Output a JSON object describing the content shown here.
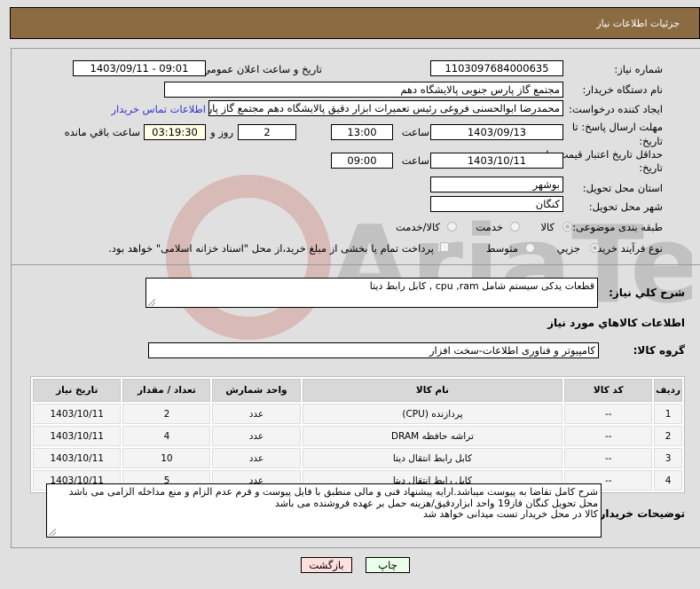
{
  "header": {
    "title": "جزئیات اطلاعات نیاز"
  },
  "fields": {
    "need_number_label": "شماره نیاز:",
    "need_number": "1103097684000635",
    "announce_label": "تاريخ و ساعت اعلان عمومي:",
    "announce_value": "1403/09/11 - 09:01",
    "buyer_org_label": "نام دستگاه خریدار:",
    "buyer_org": "مجتمع گاز پارس جنوبی  پالایشگاه دهم",
    "creator_label": "ایجاد کننده درخواست:",
    "creator": "محمدرضا ابوالحسنی فروغی رئیس تعمیرات ابزار دقیق پالایشگاه دهم  مجتمع گاز پارس جنوبی",
    "buyer_contact_link": "اطلاعات تماس خریدار",
    "reply_deadline_label_1": "مهلت ارسال پاسخ: تا",
    "reply_deadline_label_2": "تاریخ:",
    "reply_date": "1403/09/13",
    "time_label": "ساعت",
    "reply_time": "13:00",
    "days_value": "2",
    "days_label": "روز و",
    "remaining_time": "03:19:30",
    "remaining_label": "ساعت باقي مانده",
    "price_validity_label_1": "حداقل تاریخ اعتبار قیمت: تا",
    "price_validity_label_2": "تاریخ:",
    "price_validity_date": "1403/10/11",
    "price_validity_time": "09:00",
    "province_label": "استان محل تحویل:",
    "province": "بوشهر",
    "city_label": "شهر محل تحویل:",
    "city": "کنگان",
    "category_label": "طبقه بندی موضوعی:",
    "category_options": [
      "کالا",
      "خدمت",
      "کالا/خدمت"
    ],
    "category_selected": "کالا",
    "process_label": "نوع فرآیند خرید :",
    "process_options": [
      "جزیي",
      "متوسط"
    ],
    "process_selected": "جزیي",
    "treasury_checkbox_label": "پرداخت تمام یا بخشی از مبلغ خرید،از محل \"اسناد خزانه اسلامی\" خواهد بود."
  },
  "description": {
    "label": "شرح کلي نياز:",
    "value": "قطعات یدکی سیستم شامل cpu ,ram , کابل رابط دیتا"
  },
  "goods_section_title": "اطلاعات کالاهاي مورد نياز",
  "goods_group": {
    "label": "گروه کالا:",
    "value": "کامپیوتر و فناوری اطلاعات-سخت افزار"
  },
  "table": {
    "headers": [
      "ردیف",
      "کد کالا",
      "نام کالا",
      "واحد شمارش",
      "تعداد / مقدار",
      "تاریخ نیاز"
    ],
    "rows": [
      [
        "1",
        "--",
        "پردازنده (CPU)",
        "عدد",
        "2",
        "1403/10/11"
      ],
      [
        "2",
        "--",
        "تراشه حافظه DRAM",
        "عدد",
        "4",
        "1403/10/11"
      ],
      [
        "3",
        "--",
        "کابل رابط انتقال دیتا",
        "عدد",
        "10",
        "1403/10/11"
      ],
      [
        "4",
        "--",
        "کابل رابط انتقال دیتا",
        "عدد",
        "5",
        "1403/10/11"
      ]
    ]
  },
  "buyer_notes": {
    "label": "توضیحات خریدار:",
    "lines": [
      "شرح کامل تقاضا به پیوست میباشد.ارایه پیشنهاد فنی و مالی منطبق با فایل پیوست و فرم عدم الزام و منع مداخله الزامی می باشد",
      "محل تحویل کنگان فاز19 واحد ابزاردقیق/هزینه حمل بر عهده فروشنده می باشد",
      "کالا در محل خریدار تست میدانی خواهد شد"
    ]
  },
  "buttons": {
    "print": "چاپ",
    "back": "بازگشت"
  },
  "colors": {
    "header_bg": "#8b6c42",
    "print_bg": "#eaffea",
    "back_bg": "#ffdede",
    "link": "#3333cc"
  }
}
